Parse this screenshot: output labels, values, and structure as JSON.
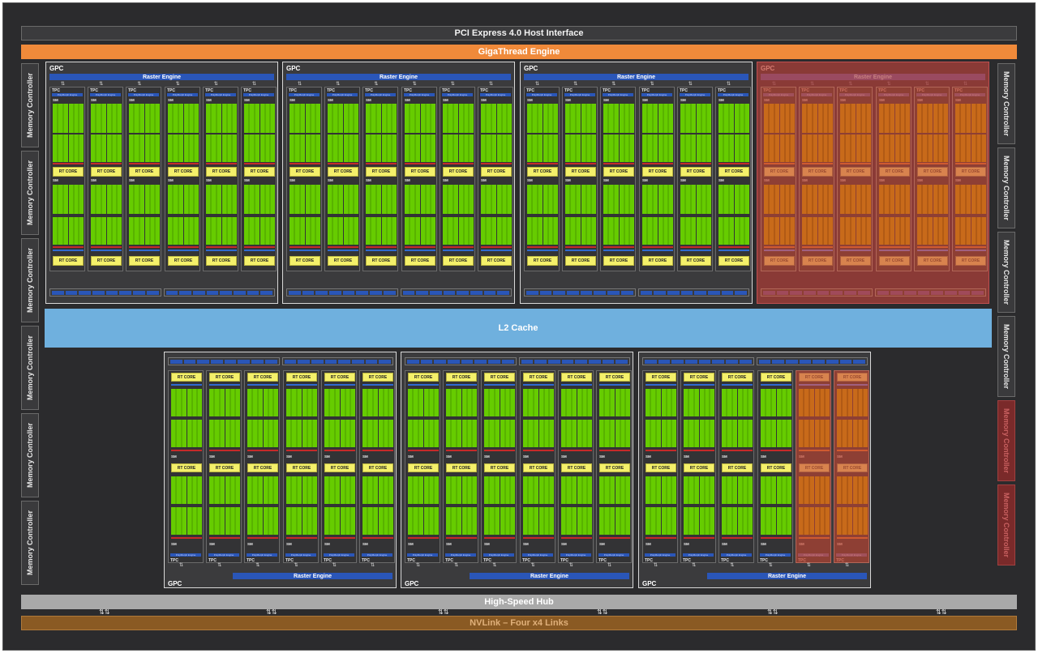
{
  "interfaces": {
    "pcie": "PCI Express 4.0 Host Interface",
    "gigathread": "GigaThread Engine",
    "l2": "L2 Cache",
    "hub": "High-Speed Hub",
    "nvlink": "NVLink – Four x4 Links"
  },
  "labels": {
    "memory_controller": "Memory Controller",
    "gpc": "GPC",
    "raster": "Raster Engine",
    "tpc": "TPC",
    "polymorph": "PolyMorph Engine",
    "sm": "SM",
    "rt_core": "RT CORE"
  },
  "memory_controllers": {
    "left": [
      {
        "label": "Memory Controller",
        "enabled": true
      },
      {
        "label": "Memory Controller",
        "enabled": true
      },
      {
        "label": "Memory Controller",
        "enabled": true
      },
      {
        "label": "Memory Controller",
        "enabled": true
      },
      {
        "label": "Memory Controller",
        "enabled": true
      },
      {
        "label": "Memory Controller",
        "enabled": true
      }
    ],
    "right": [
      {
        "label": "Memory Controller",
        "enabled": true
      },
      {
        "label": "Memory Controller",
        "enabled": true
      },
      {
        "label": "Memory Controller",
        "enabled": true
      },
      {
        "label": "Memory Controller",
        "enabled": true
      },
      {
        "label": "Memory Controller",
        "enabled": false
      },
      {
        "label": "Memory Controller",
        "enabled": false
      }
    ]
  },
  "gpcs": {
    "top": [
      {
        "label": "GPC",
        "enabled": true,
        "tpcs": [
          1,
          1,
          1,
          1,
          1,
          1
        ]
      },
      {
        "label": "GPC",
        "enabled": true,
        "tpcs": [
          1,
          1,
          1,
          1,
          1,
          1
        ]
      },
      {
        "label": "GPC",
        "enabled": true,
        "tpcs": [
          1,
          1,
          1,
          1,
          1,
          1
        ]
      },
      {
        "label": "GPC",
        "enabled": false,
        "tpcs": [
          0,
          0,
          0,
          0,
          0,
          0
        ]
      }
    ],
    "bottom": [
      {
        "label": "GPC",
        "enabled": true,
        "tpcs": [
          1,
          1,
          1,
          1,
          1,
          1
        ]
      },
      {
        "label": "GPC",
        "enabled": true,
        "tpcs": [
          1,
          1,
          1,
          1,
          1,
          1
        ]
      },
      {
        "label": "GPC",
        "enabled": true,
        "tpcs": [
          1,
          1,
          1,
          1,
          0,
          0
        ]
      }
    ]
  },
  "nvlink_ports": 6,
  "colors": {
    "background": "#2b2b2d",
    "gigathread": "#f08a3a",
    "l2": "#6fb0de",
    "raster": "#2a56b8",
    "cuda_core": "#66cc00",
    "rt_core": "#f4f06a",
    "disabled": "#8a3a36",
    "nvlink": "#8a5a23"
  }
}
